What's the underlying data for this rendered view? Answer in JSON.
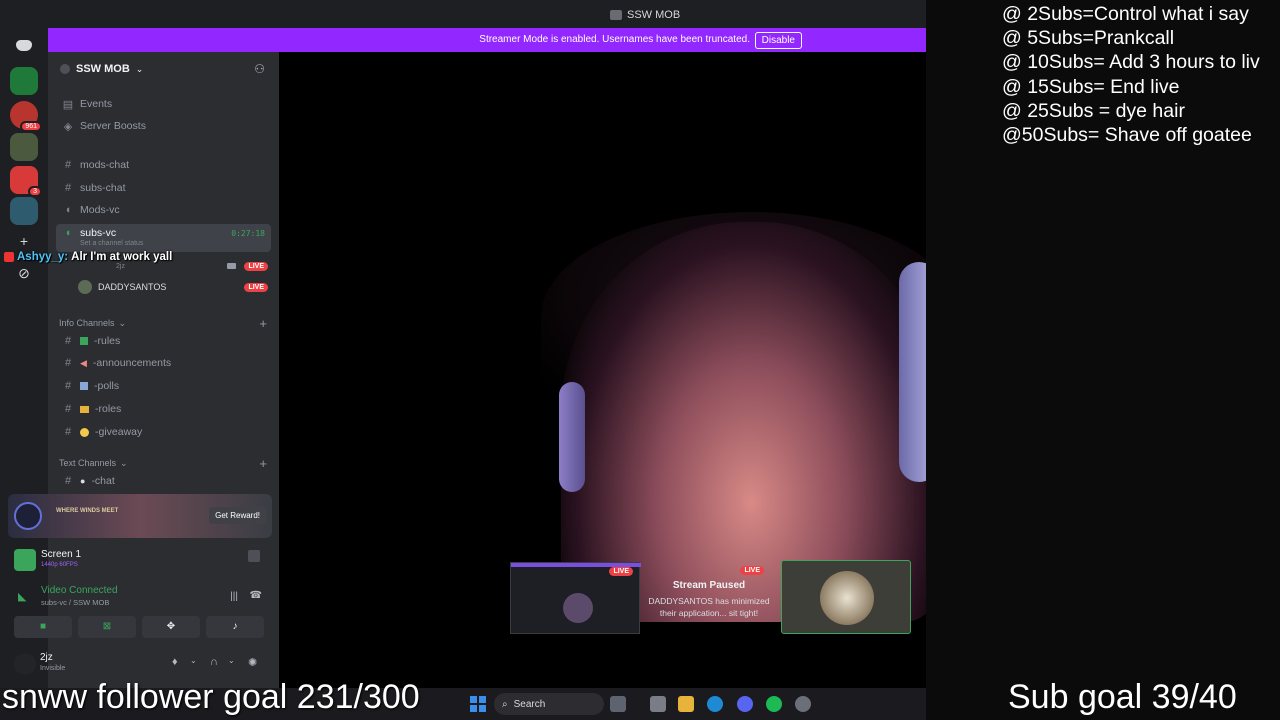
{
  "window": {
    "title": "SSW MOB",
    "streamer_banner": "Streamer Mode is enabled. Usernames have been truncated.",
    "disable_label": "Disable"
  },
  "rail": {
    "badges": [
      "961",
      "3"
    ]
  },
  "server": {
    "name": "SSW MOB",
    "chevron": "⌄",
    "invite_icon": "add-user-icon"
  },
  "channels": {
    "events": "Events",
    "boosts": "Server Boosts",
    "mods_chat": "mods-chat",
    "subs_chat": "subs-chat",
    "mods_vc": "Mods-vc",
    "subs_vc": "subs-vc",
    "subs_vc_timer": "0:27:18",
    "subs_vc_status": "Set a channel status",
    "vc_user_small": "2jz",
    "vc_live": "LIVE",
    "vc_user": "DADDYSANTOS",
    "info_category": "Info Channels",
    "rules": "-rules",
    "announcements": "-announcements",
    "polls": "-polls",
    "roles": "-roles",
    "giveaway": "-giveaway",
    "text_category": "Text Channels",
    "chat": "-chat"
  },
  "promo": {
    "logo": "WHERE WINDS MEET",
    "button": "Get Reward!"
  },
  "stream_panel": {
    "title": "Screen 1",
    "quality": "1440p 60FPS"
  },
  "voice_panel": {
    "title": "Video Connected",
    "sub": "subs-vc / SSW MOB"
  },
  "user": {
    "name": "2jz",
    "status": "Invisible"
  },
  "stream": {
    "live": "LIVE",
    "paused_title": "Stream Paused",
    "paused_text": "DADDYSANTOS has minimized their application... sit tight!"
  },
  "taskbar": {
    "search": "Search"
  },
  "overlay": {
    "chat_user": "Ashyy_y:",
    "chat_message": "Alr I'm at work yall",
    "goals": [
      "@ 2Subs=Control what i say",
      "@ 5Subs=Prankcall",
      "@ 10Subs= Add 3 hours to liv",
      "@ 15Subs= End live",
      "@ 25Subs = dye hair",
      "@50Subs=  Shave off goatee"
    ],
    "follower_goal": "snww follower goal 231/300",
    "sub_goal": "Sub goal 39/40"
  },
  "colors": {
    "blurple": "#9327ff",
    "online_green": "#3ba55c",
    "live_red": "#ed4245"
  }
}
